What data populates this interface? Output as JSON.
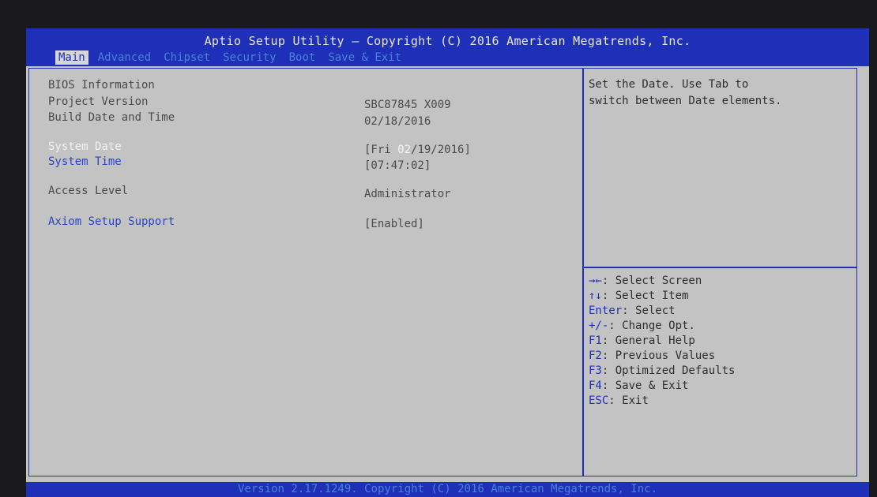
{
  "header": {
    "title": "Aptio Setup Utility – Copyright (C) 2016 American Megatrends, Inc.",
    "tabs": [
      "Main",
      "Advanced",
      "Chipset",
      "Security",
      "Boot",
      "Save & Exit"
    ]
  },
  "main": {
    "bios_info_label": "BIOS Information",
    "project_version_label": "Project Version",
    "project_version_value": "SBC87845 X009",
    "build_date_label": "Build Date and Time",
    "build_date_value": "02/18/2016",
    "system_date_label": "System Date",
    "system_date_prefix": "[Fri ",
    "system_date_month": "02",
    "system_date_rest": "/19/2016]",
    "system_time_label": "System Time",
    "system_time_value": "[07:47:02]",
    "access_level_label": "Access Level",
    "access_level_value": "Administrator",
    "axiom_label": "Axiom Setup Support",
    "axiom_value": "[Enabled]"
  },
  "help": {
    "line1": "Set the Date. Use Tab to",
    "line2": "switch between Date elements."
  },
  "keys": [
    {
      "key": "→←",
      "desc": ": Select Screen"
    },
    {
      "key": "↑↓",
      "desc": ": Select Item"
    },
    {
      "key": "Enter",
      "desc": ": Select"
    },
    {
      "key": "+/-",
      "desc": ": Change Opt."
    },
    {
      "key": "F1",
      "desc": ": General Help"
    },
    {
      "key": "F2",
      "desc": ": Previous Values"
    },
    {
      "key": "F3",
      "desc": ": Optimized Defaults"
    },
    {
      "key": "F4",
      "desc": ": Save & Exit"
    },
    {
      "key": "ESC",
      "desc": ": Exit"
    }
  ],
  "footer": "Version 2.17.1249. Copyright (C) 2016 American Megatrends, Inc."
}
